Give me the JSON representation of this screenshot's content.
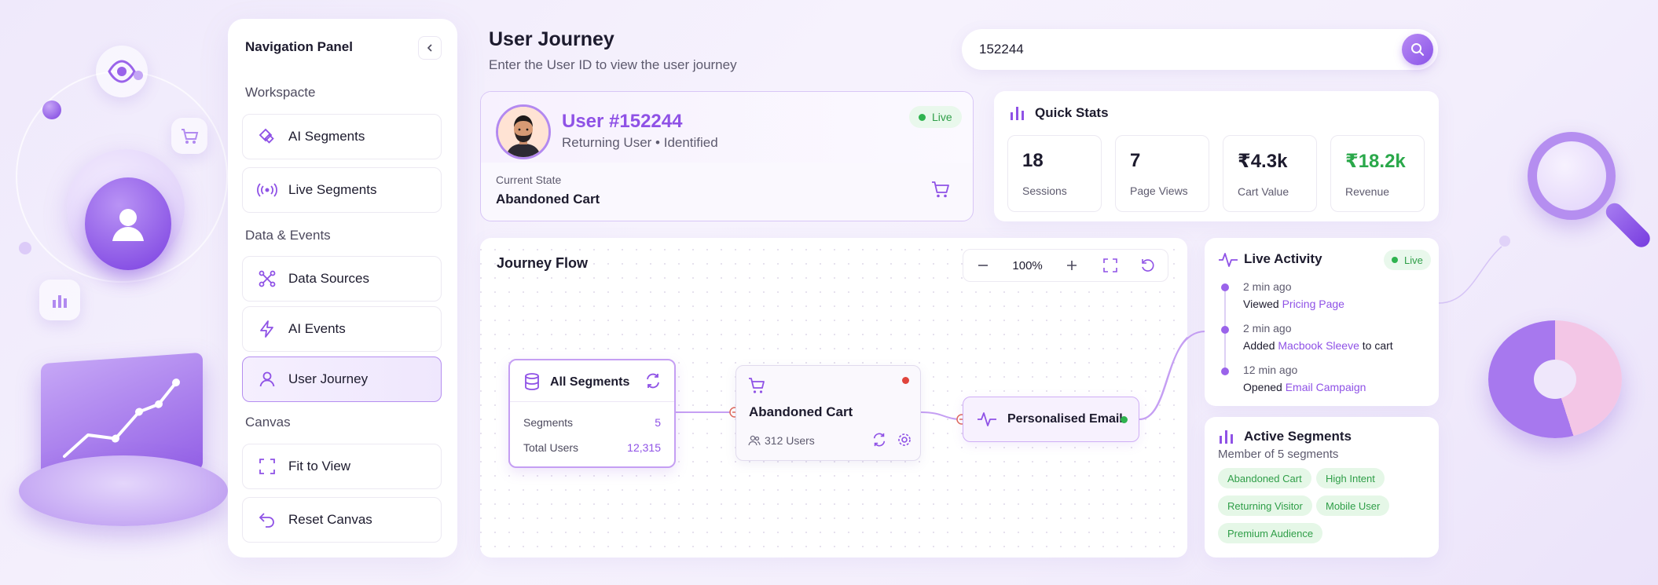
{
  "nav": {
    "title": "Navigation Panel",
    "sections": [
      {
        "label": "Workspacte",
        "items": [
          {
            "label": "AI Segments",
            "icon": "diamond-icon"
          },
          {
            "label": "Live Segments",
            "icon": "broadcast-icon"
          }
        ]
      },
      {
        "label": "Data & Events",
        "items": [
          {
            "label": "Data Sources",
            "icon": "nodes-icon"
          },
          {
            "label": "AI Events",
            "icon": "lightning-icon"
          },
          {
            "label": "User Journey",
            "icon": "user-icon",
            "active": true
          }
        ]
      },
      {
        "label": "Canvas",
        "items": [
          {
            "label": "Fit to View",
            "icon": "fit-icon"
          },
          {
            "label": "Reset Canvas",
            "icon": "undo-icon"
          }
        ]
      }
    ]
  },
  "header": {
    "title": "User Journey",
    "subtitle": "Enter the User ID to view the user journey"
  },
  "search": {
    "value": "152244"
  },
  "user": {
    "name": "User #152244",
    "type": "Returning User • Identified",
    "live_label": "Live",
    "state_label": "Current State",
    "state_value": "Abandoned Cart"
  },
  "quick_stats": {
    "title": "Quick Stats",
    "items": [
      {
        "value": "18",
        "label": "Sessions"
      },
      {
        "value": "7",
        "label": "Page Views"
      },
      {
        "value": "₹4.3k",
        "label": "Cart Value"
      },
      {
        "value": "₹18.2k",
        "label": "Revenue"
      }
    ]
  },
  "journey": {
    "title": "Journey Flow",
    "zoom": "100%",
    "all_segments": {
      "title": "All Segments",
      "rows": [
        {
          "label": "Segments",
          "value": "5"
        },
        {
          "label": "Total Users",
          "value": "12,315"
        }
      ]
    },
    "abandoned_cart": {
      "title": "Abandoned Cart",
      "users": "312 Users"
    },
    "email": {
      "title": "Personalised Email"
    }
  },
  "activity": {
    "title": "Live Activity",
    "live_label": "Live",
    "items": [
      {
        "time": "2 min ago",
        "prefix": "Viewed ",
        "link": "Pricing Page",
        "suffix": ""
      },
      {
        "time": "2 min ago",
        "prefix": "Added ",
        "link": "Macbook Sleeve",
        "suffix": " to cart"
      },
      {
        "time": "12 min ago",
        "prefix": "Opened ",
        "link": "Email Campaign",
        "suffix": ""
      }
    ]
  },
  "segments": {
    "title": "Active Segments",
    "subtitle": "Member of 5 segments",
    "tags": [
      "Abandoned Cart",
      "High Intent",
      "Returning Visitor",
      "Mobile User",
      "Premium Audience"
    ]
  },
  "colors": {
    "accent": "#8f52e6",
    "live": "#2fb34f",
    "revenue": "#2aa84a",
    "alert": "#e0443c"
  }
}
